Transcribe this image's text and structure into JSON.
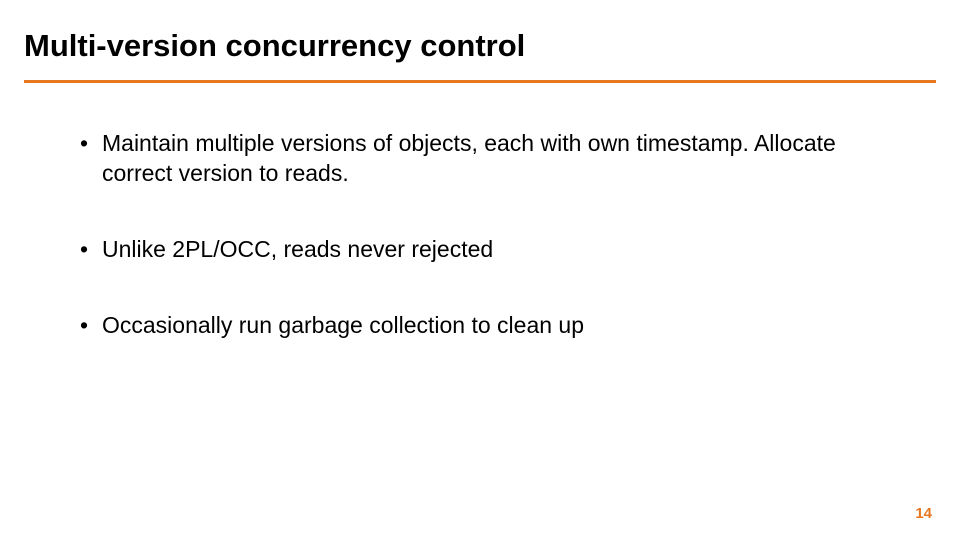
{
  "title": "Multi-version concurrency control",
  "bullets": [
    "Maintain multiple versions of objects, each with own timestamp. Allocate correct version to reads.",
    "Unlike 2PL/OCC, reads never rejected",
    "Occasionally run garbage collection to clean up"
  ],
  "pageNumber": "14",
  "accentColor": "#e87722"
}
